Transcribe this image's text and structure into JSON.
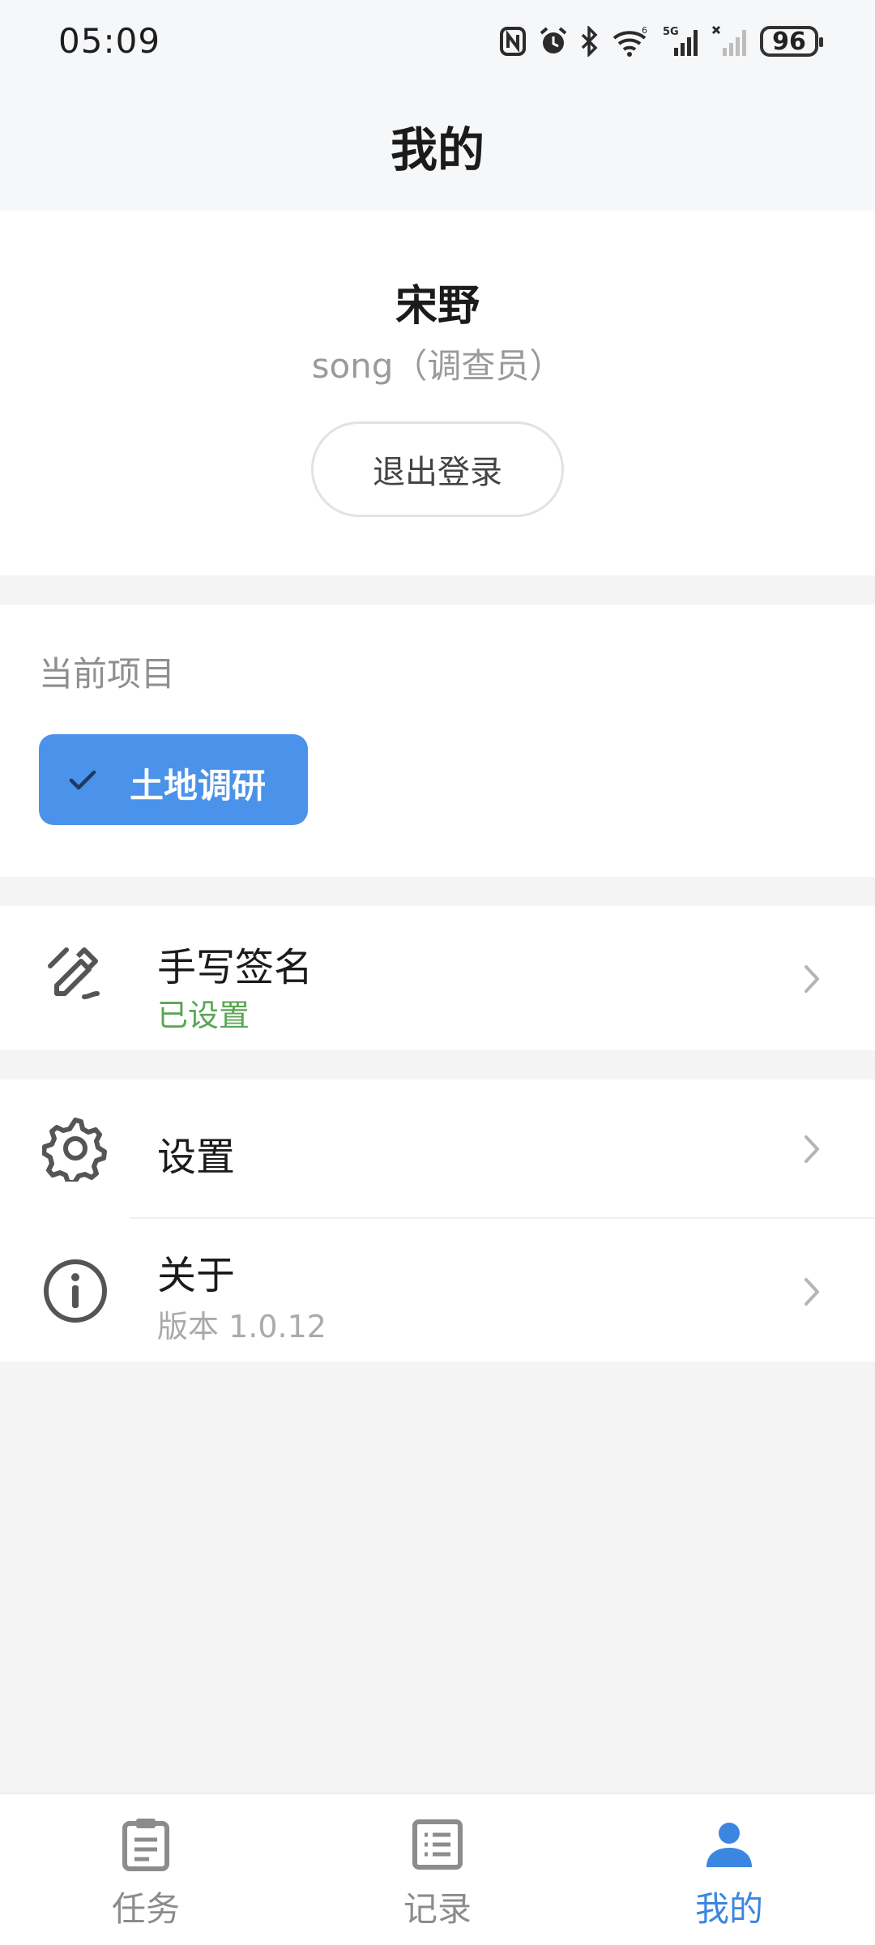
{
  "status_bar": {
    "time": "05:09",
    "battery": "96",
    "icons": [
      "nfc-icon",
      "alarm-icon",
      "bluetooth-icon",
      "wifi-icon",
      "signal-5g-icon",
      "signal-icon",
      "battery-icon"
    ]
  },
  "header": {
    "title": "我的"
  },
  "profile": {
    "name": "宋野",
    "subtitle": "song（调查员）",
    "logout_label": "退出登录"
  },
  "project": {
    "section_label": "当前项目",
    "selected": "土地调研",
    "accent_color": "#4a92ea"
  },
  "menu": {
    "signature": {
      "title": "手写签名",
      "status": "已设置",
      "status_color": "#5aa553"
    },
    "settings": {
      "title": "设置"
    },
    "about": {
      "title": "关于",
      "version": "版本 1.0.12"
    }
  },
  "tabbar": {
    "active_color": "#3b86e0",
    "inactive_color": "#8c8c8c",
    "tabs": [
      {
        "label": "任务",
        "icon": "clipboard-icon",
        "active": false
      },
      {
        "label": "记录",
        "icon": "list-icon",
        "active": false
      },
      {
        "label": "我的",
        "icon": "person-icon",
        "active": true
      }
    ]
  }
}
